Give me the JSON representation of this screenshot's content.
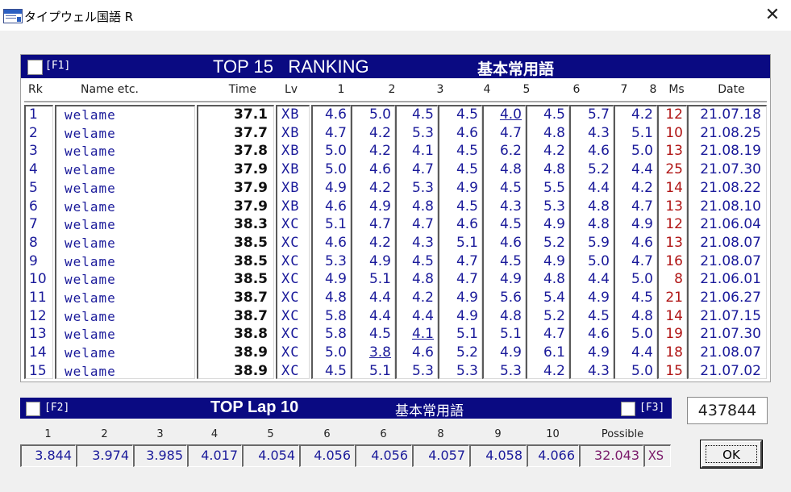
{
  "window": {
    "title": "タイプウェル国語 R",
    "close_glyph": "✕"
  },
  "ranking": {
    "f_key": "[F1]",
    "title": "TOP 15   RANKING",
    "subtitle": "基本常用語",
    "columns": [
      "Rk",
      "Name etc.",
      "Time",
      "Lv",
      "1",
      "2",
      "3",
      "4",
      "5",
      "6",
      "7",
      "8",
      "Ms",
      "Date"
    ],
    "rows": [
      {
        "rk": "1",
        "name": "welame",
        "time": "37.1",
        "lv": "XB",
        "laps": [
          "4.6",
          "5.0",
          "4.5",
          "4.5",
          "4.0",
          "4.5",
          "5.7",
          "4.2"
        ],
        "ms": "12",
        "date": "21.07.18"
      },
      {
        "rk": "2",
        "name": "welame",
        "time": "37.7",
        "lv": "XB",
        "laps": [
          "4.7",
          "4.2",
          "5.3",
          "4.6",
          "4.7",
          "4.8",
          "4.3",
          "5.1"
        ],
        "ms": "10",
        "date": "21.08.25"
      },
      {
        "rk": "3",
        "name": "welame",
        "time": "37.8",
        "lv": "XB",
        "laps": [
          "5.0",
          "4.2",
          "4.1",
          "4.5",
          "6.2",
          "4.2",
          "4.6",
          "5.0"
        ],
        "ms": "13",
        "date": "21.08.19"
      },
      {
        "rk": "4",
        "name": "welame",
        "time": "37.9",
        "lv": "XB",
        "laps": [
          "5.0",
          "4.6",
          "4.7",
          "4.5",
          "4.8",
          "4.8",
          "5.2",
          "4.4"
        ],
        "ms": "25",
        "date": "21.07.30"
      },
      {
        "rk": "5",
        "name": "welame",
        "time": "37.9",
        "lv": "XB",
        "laps": [
          "4.9",
          "4.2",
          "5.3",
          "4.9",
          "4.5",
          "5.5",
          "4.4",
          "4.2"
        ],
        "ms": "14",
        "date": "21.08.22"
      },
      {
        "rk": "6",
        "name": "welame",
        "time": "37.9",
        "lv": "XB",
        "laps": [
          "4.6",
          "4.9",
          "4.8",
          "4.5",
          "4.3",
          "5.3",
          "4.8",
          "4.7"
        ],
        "ms": "13",
        "date": "21.08.10"
      },
      {
        "rk": "7",
        "name": "welame",
        "time": "38.3",
        "lv": "XC",
        "laps": [
          "5.1",
          "4.7",
          "4.7",
          "4.6",
          "4.5",
          "4.9",
          "4.8",
          "4.9"
        ],
        "ms": "12",
        "date": "21.06.04"
      },
      {
        "rk": "8",
        "name": "welame",
        "time": "38.5",
        "lv": "XC",
        "laps": [
          "4.6",
          "4.2",
          "4.3",
          "5.1",
          "4.6",
          "5.2",
          "5.9",
          "4.6"
        ],
        "ms": "13",
        "date": "21.08.07"
      },
      {
        "rk": "9",
        "name": "welame",
        "time": "38.5",
        "lv": "XC",
        "laps": [
          "5.3",
          "4.9",
          "4.5",
          "4.7",
          "4.5",
          "4.9",
          "5.0",
          "4.7"
        ],
        "ms": "16",
        "date": "21.08.07"
      },
      {
        "rk": "10",
        "name": "welame",
        "time": "38.5",
        "lv": "XC",
        "laps": [
          "4.9",
          "5.1",
          "4.8",
          "4.7",
          "4.9",
          "4.8",
          "4.4",
          "5.0"
        ],
        "ms": "8",
        "date": "21.06.01"
      },
      {
        "rk": "11",
        "name": "welame",
        "time": "38.7",
        "lv": "XC",
        "laps": [
          "4.8",
          "4.4",
          "4.2",
          "4.9",
          "5.6",
          "5.4",
          "4.9",
          "4.5"
        ],
        "ms": "21",
        "date": "21.06.27"
      },
      {
        "rk": "12",
        "name": "welame",
        "time": "38.7",
        "lv": "XC",
        "laps": [
          "5.8",
          "4.4",
          "4.4",
          "4.9",
          "4.8",
          "5.2",
          "4.5",
          "4.8"
        ],
        "ms": "14",
        "date": "21.07.15"
      },
      {
        "rk": "13",
        "name": "welame",
        "time": "38.8",
        "lv": "XC",
        "laps": [
          "5.8",
          "4.5",
          "4.1",
          "5.1",
          "5.1",
          "4.7",
          "4.6",
          "5.0"
        ],
        "ms": "19",
        "date": "21.07.30"
      },
      {
        "rk": "14",
        "name": "welame",
        "time": "38.9",
        "lv": "XC",
        "laps": [
          "5.0",
          "3.8",
          "4.6",
          "5.2",
          "4.9",
          "6.1",
          "4.9",
          "4.4"
        ],
        "ms": "18",
        "date": "21.08.07"
      },
      {
        "rk": "15",
        "name": "welame",
        "time": "38.9",
        "lv": "XC",
        "laps": [
          "4.5",
          "5.1",
          "5.3",
          "5.3",
          "5.3",
          "4.2",
          "4.3",
          "5.0"
        ],
        "ms": "15",
        "date": "21.07.02"
      }
    ]
  },
  "lap": {
    "f_key_left": "[F2]",
    "title": "TOP Lap 10",
    "subtitle": "基本常用語",
    "f_key_right": "[F3]",
    "labels": [
      "1",
      "2",
      "3",
      "4",
      "5",
      "6",
      "6",
      "8",
      "9",
      "10"
    ],
    "values": [
      "3.844",
      "3.974",
      "3.985",
      "4.017",
      "4.054",
      "4.056",
      "4.056",
      "4.057",
      "4.058",
      "4.066"
    ],
    "possible_label": "Possible",
    "possible_value": "32.043",
    "possible_level": "XS"
  },
  "counter": "437844",
  "ok_label": "OK",
  "colors": {
    "header_bg": "#0a0a82",
    "value_blue": "#1a1a9a",
    "miss_red": "#b01515",
    "possible_purple": "#7a1a6a"
  }
}
